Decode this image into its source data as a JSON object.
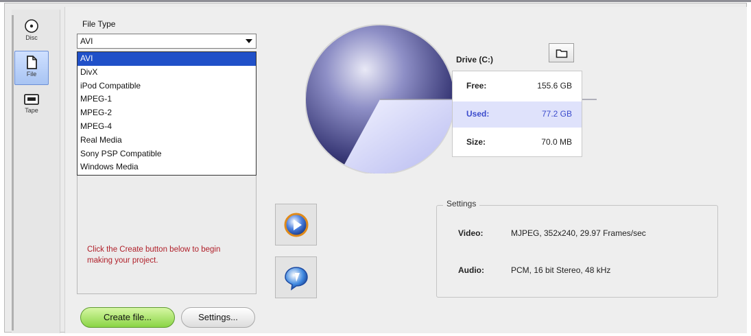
{
  "sidebar": {
    "tabs": [
      {
        "label": "Disc",
        "icon": "disc-icon"
      },
      {
        "label": "File",
        "icon": "file-icon",
        "selected": true
      },
      {
        "label": "Tape",
        "icon": "tape-icon"
      }
    ]
  },
  "file_type": {
    "label": "File Type",
    "selected": "AVI",
    "options": [
      "AVI",
      "DivX",
      "iPod Compatible",
      "MPEG-1",
      "MPEG-2",
      "MPEG-4",
      "Real Media",
      "Sony PSP Compatible",
      "Windows Media"
    ]
  },
  "hint": "Click the Create button below to begin making your project.",
  "buttons": {
    "create": "Create file...",
    "settings": "Settings..."
  },
  "drive": {
    "title": "Drive (C:)",
    "stats": [
      {
        "key": "Free:",
        "value": "155.6 GB"
      },
      {
        "key": "Used:",
        "value": "77.2 GB"
      },
      {
        "key": "Size:",
        "value": "70.0 MB"
      }
    ]
  },
  "settings_group": {
    "legend": "Settings",
    "video_label": "Video:",
    "video_value": "MJPEG, 352x240, 29.97 Frames/sec",
    "audio_label": "Audio:",
    "audio_value": "PCM, 16 bit Stereo, 48 kHz"
  },
  "colors": {
    "selection": "#2050c8",
    "hint_text": "#b0202a",
    "create_button": "#8ad445",
    "used_highlight": "#dfe2fb"
  }
}
